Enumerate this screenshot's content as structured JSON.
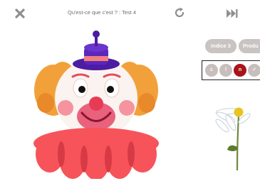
{
  "header": {
    "title": "Qu'est-ce que c'est ? : Test 4",
    "close_icon": "close-icon",
    "reload_icon": "reload-icon",
    "skip_icon": "skip-forward-icon"
  },
  "hints": [
    {
      "label": "Indice 3"
    },
    {
      "label": "Produ"
    }
  ],
  "letters": [
    "c",
    "l",
    "n",
    "✓"
  ],
  "colors": {
    "pill": "#c9c3c1",
    "letter_active": "#a8141a",
    "letter_inactive": "#c8bebb",
    "icon": "#8f8f8f"
  }
}
